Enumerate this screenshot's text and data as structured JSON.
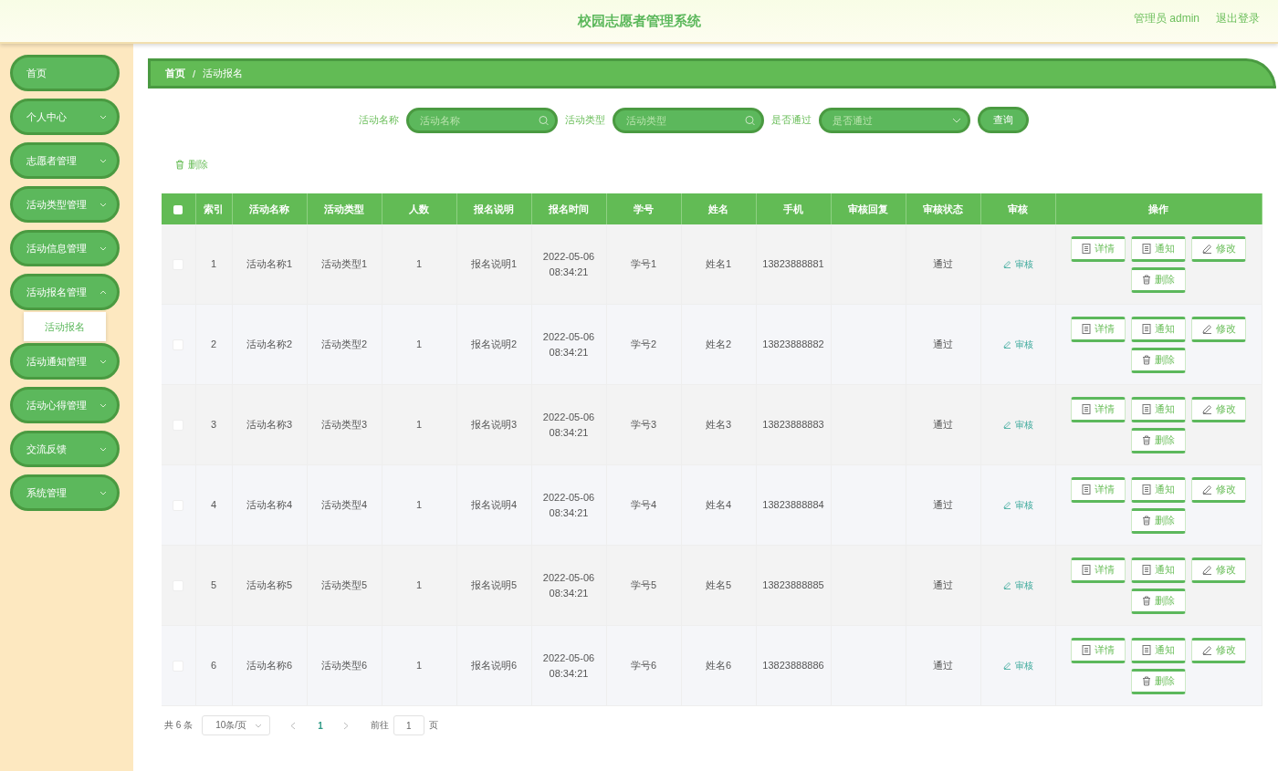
{
  "header": {
    "title": "校园志愿者管理系统",
    "user": "管理员 admin",
    "logout": "退出登录"
  },
  "sidebar": {
    "items": [
      {
        "label": "首页",
        "kind": "link"
      },
      {
        "label": "个人中心",
        "kind": "group",
        "expanded": false
      },
      {
        "label": "志愿者管理",
        "kind": "group",
        "expanded": false
      },
      {
        "label": "活动类型管理",
        "kind": "group",
        "expanded": false
      },
      {
        "label": "活动信息管理",
        "kind": "group",
        "expanded": false
      },
      {
        "label": "活动报名管理",
        "kind": "group",
        "expanded": true,
        "children": [
          {
            "label": "活动报名"
          }
        ]
      },
      {
        "label": "活动通知管理",
        "kind": "group",
        "expanded": false
      },
      {
        "label": "活动心得管理",
        "kind": "group",
        "expanded": false
      },
      {
        "label": "交流反馈",
        "kind": "group",
        "expanded": false
      },
      {
        "label": "系统管理",
        "kind": "group",
        "expanded": false
      }
    ]
  },
  "breadcrumb": {
    "separator": "/",
    "items": [
      {
        "label": "首页"
      },
      {
        "label": "活动报名"
      }
    ]
  },
  "search": {
    "fields": [
      {
        "label": "活动名称",
        "placeholder": "活动名称",
        "kind": "input"
      },
      {
        "label": "活动类型",
        "placeholder": "活动类型",
        "kind": "input"
      },
      {
        "label": "是否通过",
        "placeholder": "是否通过",
        "kind": "select"
      }
    ],
    "button": "查询"
  },
  "toolbar": {
    "delete": "删除"
  },
  "table": {
    "all_checked": false,
    "columns": [
      "索引",
      "活动名称",
      "活动类型",
      "人数",
      "报名说明",
      "报名时间",
      "学号",
      "姓名",
      "手机",
      "审核回复",
      "审核状态",
      "审核",
      "操作"
    ],
    "rows": [
      {
        "checked": false,
        "cells": [
          "1",
          "活动名称1",
          "活动类型1",
          "1",
          "报名说明1",
          "2022-05-06 08:34:21",
          "学号1",
          "姓名1",
          "13823888881",
          "",
          "通过"
        ],
        "audit": "审核",
        "actions": [
          {
            "kind": "detail",
            "label": "详情"
          },
          {
            "kind": "notice",
            "label": "通知"
          },
          {
            "kind": "edit",
            "label": "修改"
          },
          {
            "kind": "delete",
            "label": "删除"
          }
        ]
      },
      {
        "checked": false,
        "cells": [
          "2",
          "活动名称2",
          "活动类型2",
          "1",
          "报名说明2",
          "2022-05-06 08:34:21",
          "学号2",
          "姓名2",
          "13823888882",
          "",
          "通过"
        ],
        "audit": "审核",
        "actions": [
          {
            "kind": "detail",
            "label": "详情"
          },
          {
            "kind": "notice",
            "label": "通知"
          },
          {
            "kind": "edit",
            "label": "修改"
          },
          {
            "kind": "delete",
            "label": "删除"
          }
        ]
      },
      {
        "checked": false,
        "cells": [
          "3",
          "活动名称3",
          "活动类型3",
          "1",
          "报名说明3",
          "2022-05-06 08:34:21",
          "学号3",
          "姓名3",
          "13823888883",
          "",
          "通过"
        ],
        "audit": "审核",
        "actions": [
          {
            "kind": "detail",
            "label": "详情"
          },
          {
            "kind": "notice",
            "label": "通知"
          },
          {
            "kind": "edit",
            "label": "修改"
          },
          {
            "kind": "delete",
            "label": "删除"
          }
        ]
      },
      {
        "checked": false,
        "cells": [
          "4",
          "活动名称4",
          "活动类型4",
          "1",
          "报名说明4",
          "2022-05-06 08:34:21",
          "学号4",
          "姓名4",
          "13823888884",
          "",
          "通过"
        ],
        "audit": "审核",
        "actions": [
          {
            "kind": "detail",
            "label": "详情"
          },
          {
            "kind": "notice",
            "label": "通知"
          },
          {
            "kind": "edit",
            "label": "修改"
          },
          {
            "kind": "delete",
            "label": "删除"
          }
        ]
      },
      {
        "checked": false,
        "cells": [
          "5",
          "活动名称5",
          "活动类型5",
          "1",
          "报名说明5",
          "2022-05-06 08:34:21",
          "学号5",
          "姓名5",
          "13823888885",
          "",
          "通过"
        ],
        "audit": "审核",
        "actions": [
          {
            "kind": "detail",
            "label": "详情"
          },
          {
            "kind": "notice",
            "label": "通知"
          },
          {
            "kind": "edit",
            "label": "修改"
          },
          {
            "kind": "delete",
            "label": "删除"
          }
        ]
      },
      {
        "checked": false,
        "cells": [
          "6",
          "活动名称6",
          "活动类型6",
          "1",
          "报名说明6",
          "2022-05-06 08:34:21",
          "学号6",
          "姓名6",
          "13823888886",
          "",
          "通过"
        ],
        "audit": "审核",
        "actions": [
          {
            "kind": "detail",
            "label": "详情"
          },
          {
            "kind": "notice",
            "label": "通知"
          },
          {
            "kind": "edit",
            "label": "修改"
          },
          {
            "kind": "delete",
            "label": "删除"
          }
        ]
      }
    ]
  },
  "pagination": {
    "total": "共 6 条",
    "page_size": "10条/页",
    "pages": [
      {
        "label": "1",
        "selected": true
      }
    ],
    "goto_label": "前往",
    "goto_value": "1",
    "goto_suffix": "页"
  }
}
